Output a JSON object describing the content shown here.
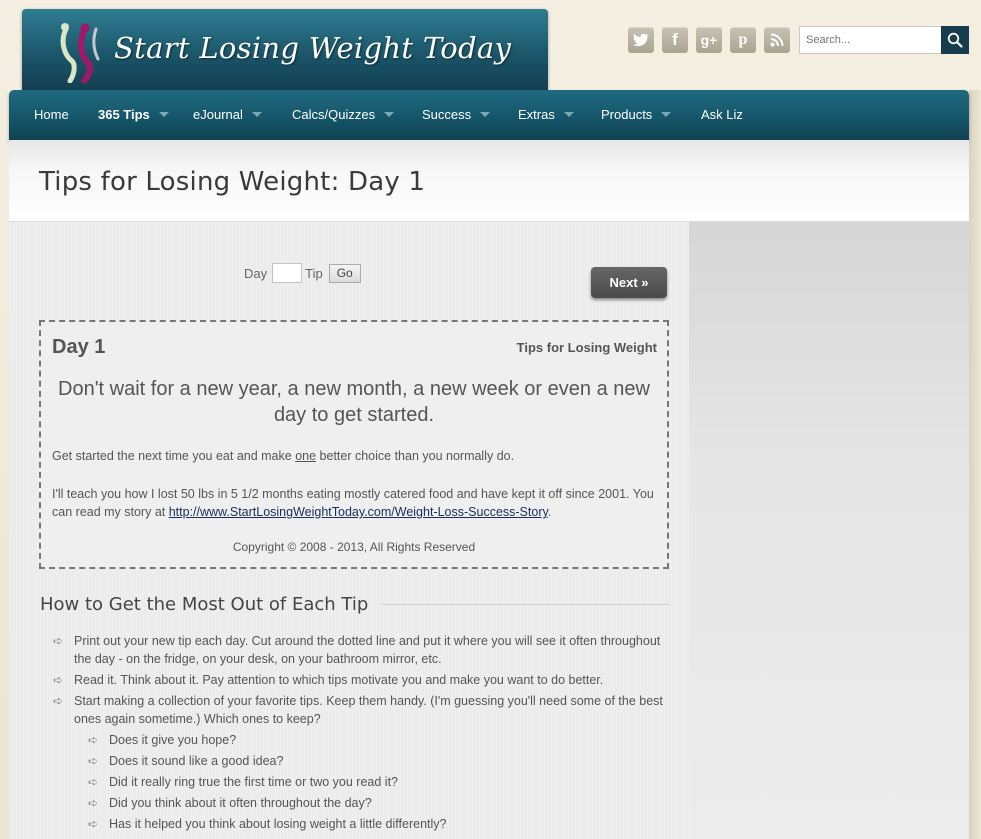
{
  "header": {
    "logo_text": "Start Losing Weight Today",
    "social": [
      {
        "icon": "twitter-icon",
        "glyph": "t"
      },
      {
        "icon": "facebook-icon",
        "glyph": "f"
      },
      {
        "icon": "google-plus-icon",
        "glyph": "g+"
      },
      {
        "icon": "pinterest-icon",
        "glyph": "p"
      },
      {
        "icon": "rss-icon",
        "glyph": "≋"
      }
    ],
    "search_placeholder": "Search..."
  },
  "nav": {
    "items": [
      {
        "label": "Home"
      },
      {
        "label": "365 Tips"
      },
      {
        "label": "eJournal"
      },
      {
        "label": "Calcs/Quizzes"
      },
      {
        "label": "Success"
      },
      {
        "label": "Extras"
      },
      {
        "label": "Products"
      },
      {
        "label": "Ask Liz"
      }
    ]
  },
  "page": {
    "title": "Tips for Losing Weight: Day 1"
  },
  "form": {
    "day_label": "Day",
    "tip_label": "Tip",
    "go_label": "Go",
    "next_label": "Next »"
  },
  "tip": {
    "day": "Day 1",
    "label": "Tips for Losing Weight",
    "main": "Don't wait for a new year, a new month, a new week or even a new day to get started.",
    "p1_before": "Get started the next time you eat and make ",
    "p1_emph": "one",
    "p1_after": " better choice than you normally do.",
    "p2_text": "I'll teach you how I lost 50 lbs in 5 1/2 months eating mostly catered food and have kept it off since 2001. You can read my story at ",
    "p2_link": "http://www.StartLosingWeightToday.com/Weight-Loss-Success-Story",
    "p2_end": ".",
    "copyright": "Copyright © 2008 - 2013, All Rights Reserved"
  },
  "section": {
    "title": "How to Get the Most Out of Each Tip",
    "items": [
      "Print out your new tip each day. Cut around the dotted line and put it where you will see it often throughout the day - on the fridge, on your desk, on your bathroom mirror, etc.",
      "Read it. Think about it. Pay attention to which tips motivate you and make you want to do better.",
      "Start making a collection of your favorite tips. Keep them handy. (I'm guessing you'll need some of the best ones again sometime.) Which ones to keep?"
    ],
    "sub_items": [
      "Does it give you hope?",
      "Does it sound like a good idea?",
      "Did it really ring true the first time or two you read it?",
      "Did you think about it often throughout the day?",
      "Has it helped you think about losing weight a little differently?"
    ]
  }
}
